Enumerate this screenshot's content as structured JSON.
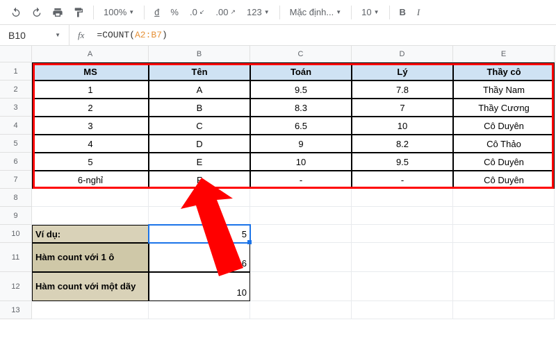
{
  "toolbar": {
    "zoom": "100%",
    "currency": "đ",
    "percent": "%",
    "dec1": ".0",
    "dec2": ".00",
    "num": "123",
    "font": "Mặc định...",
    "font_size": "10",
    "bold": "B",
    "italic": "I"
  },
  "formula_bar": {
    "cell_ref": "B10",
    "fx": "fx",
    "prefix": "=COUNT(",
    "arg": "A2:B7",
    "suffix": ")"
  },
  "col_headers": [
    "A",
    "B",
    "C",
    "D",
    "E"
  ],
  "row_numbers": [
    "1",
    "2",
    "3",
    "4",
    "5",
    "6",
    "7",
    "8",
    "9",
    "10",
    "11",
    "12",
    "13"
  ],
  "table": {
    "headers": [
      "MS",
      "Tên",
      "Toán",
      "Lý",
      "Thầy cô"
    ],
    "rows": [
      [
        "1",
        "A",
        "9.5",
        "7.8",
        "Thầy Nam"
      ],
      [
        "2",
        "B",
        "8.3",
        "7",
        "Thầy Cương"
      ],
      [
        "3",
        "C",
        "6.5",
        "10",
        "Cô Duyên"
      ],
      [
        "4",
        "D",
        "9",
        "8.2",
        "Cô Thảo"
      ],
      [
        "5",
        "E",
        "10",
        "9.5",
        "Cô Duyên"
      ],
      [
        "6-nghỉ",
        "F",
        "-",
        "-",
        "Cô Duyên"
      ]
    ]
  },
  "examples": {
    "r10_label": "Ví dụ:",
    "r10_val": "5",
    "r11_label": "Hàm count với 1 ô",
    "r11_val": "6",
    "r12_label": "Hàm count với một dãy",
    "r12_val": "10"
  },
  "colors": {
    "accent": "#1a73e8",
    "red": "#ff0000",
    "header_bg": "#cfe2f3",
    "beige": "#d9d2b8"
  }
}
